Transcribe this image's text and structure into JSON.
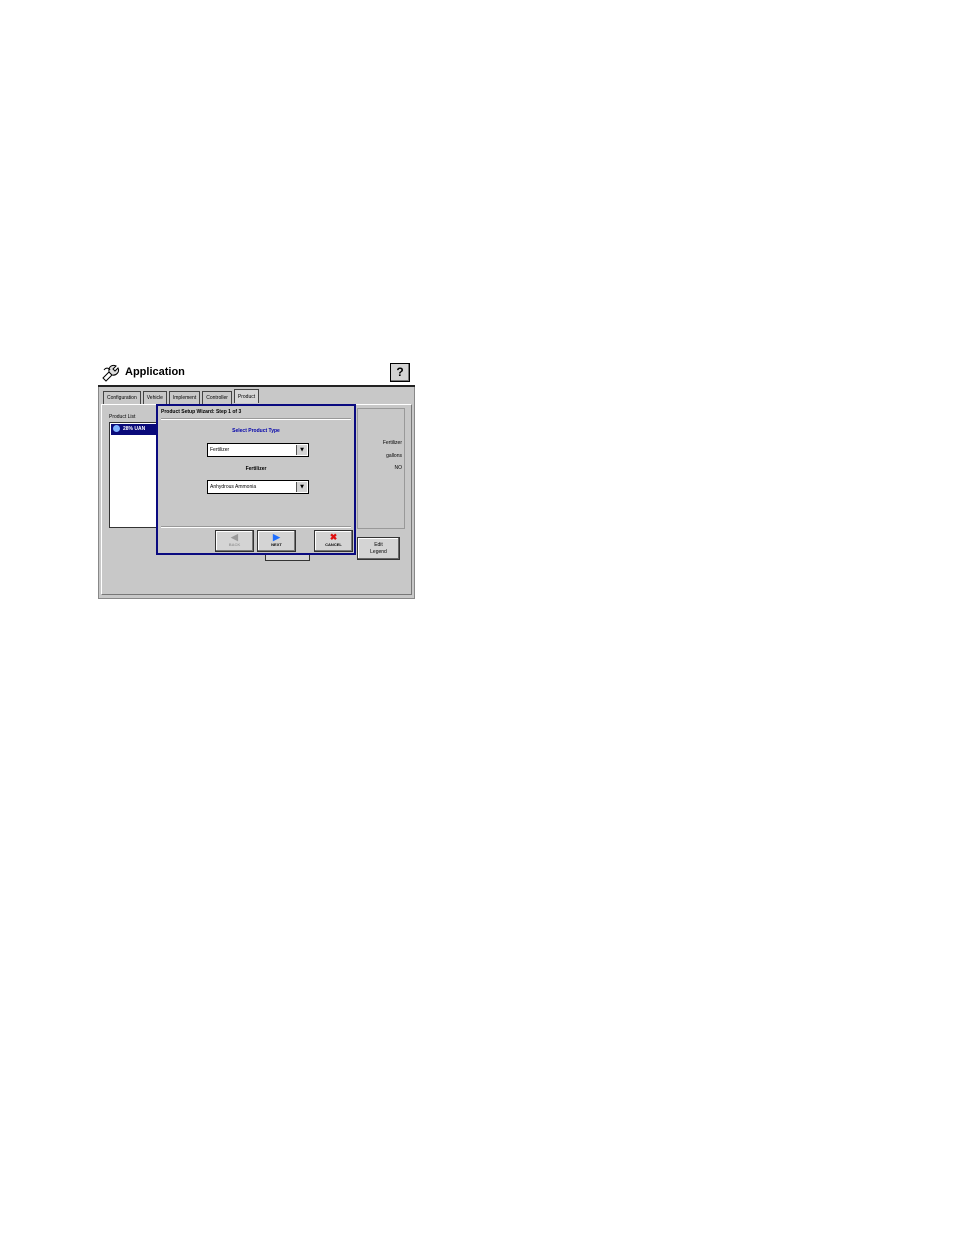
{
  "app": {
    "title": "Application",
    "help_label": "?"
  },
  "tabs": [
    {
      "label": "Configuration"
    },
    {
      "label": "Vehicle"
    },
    {
      "label": "Implement"
    },
    {
      "label": "Controller"
    },
    {
      "label": "Product",
      "active": true
    }
  ],
  "product_list": {
    "label": "Product List",
    "items": [
      {
        "name": "28% UAN",
        "selected": true
      }
    ]
  },
  "details": {
    "type": "Fertilizer",
    "units": "gallons",
    "flag": "NO"
  },
  "edit_button": {
    "label_line1": "Edit",
    "label_line2": "Legend"
  },
  "wizard": {
    "title": "Product Setup Wizard: Step 1 of 3",
    "heading": "Select Product Type",
    "type_select": {
      "value": "Fertilizer"
    },
    "sub_label": "Fertilizer",
    "product_select": {
      "value": "Anhydrous Ammonia"
    },
    "back_label": "BACK",
    "next_label": "NEXT",
    "cancel_label": "CANCEL"
  },
  "colors": {
    "accent": "#0a0a80",
    "selection": "#0a0a7a",
    "heading": "#0000aa",
    "cancel_icon": "#e01010",
    "next_icon": "#1f6fff"
  }
}
